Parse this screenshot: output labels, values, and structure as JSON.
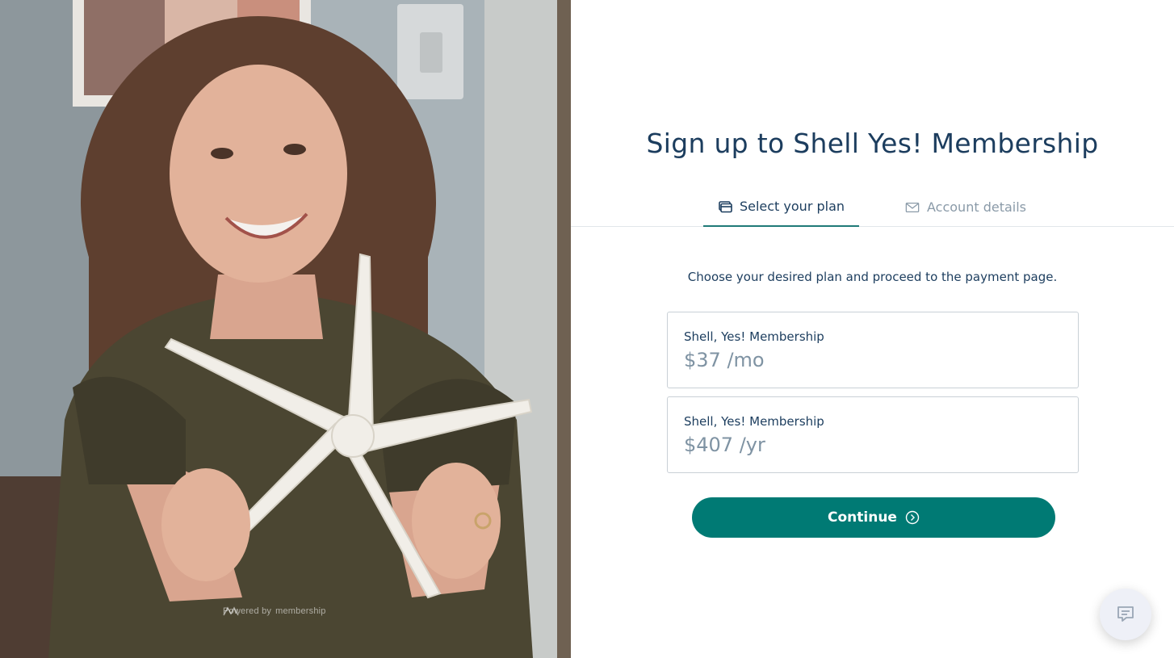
{
  "hero": {
    "powered_by_label": "Powered by",
    "brand_name": "membership"
  },
  "signup": {
    "title": "Sign up to Shell Yes! Membership",
    "tabs": [
      {
        "label": "Select your plan",
        "icon": "credit-card-icon",
        "active": true
      },
      {
        "label": "Account details",
        "icon": "envelope-icon",
        "active": false
      }
    ],
    "instruction": "Choose your desired plan and proceed to the payment page.",
    "plans": [
      {
        "name": "Shell, Yes! Membership",
        "price": "$37 /mo"
      },
      {
        "name": "Shell, Yes! Membership",
        "price": "$407 /yr"
      }
    ],
    "continue_label": "Continue"
  },
  "chat": {
    "icon": "chat-icon"
  },
  "colors": {
    "accent": "#007a74",
    "title": "#1c3d5e",
    "muted": "#8a9aa8"
  }
}
